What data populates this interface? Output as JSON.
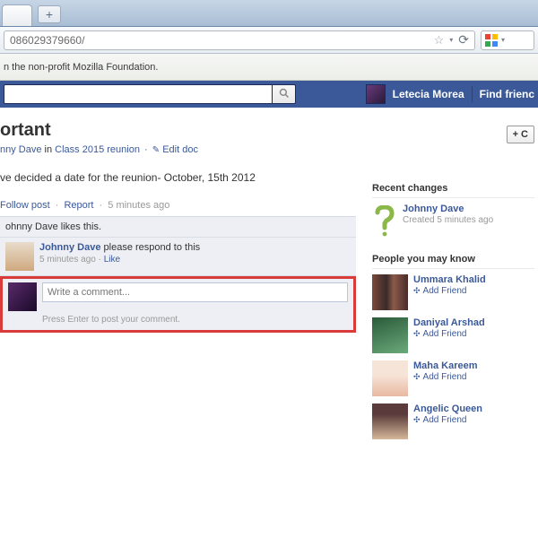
{
  "browser": {
    "url_fragment": "086029379660/",
    "bookmark_bar_text": "n the non-profit Mozilla Foundation."
  },
  "header": {
    "user_name": "Letecia Morea",
    "find_friends": "Find frienc"
  },
  "post": {
    "title": "ortant",
    "author": "nny Dave",
    "in_word": "in",
    "group": "Class 2015 reunion",
    "edit_label": "Edit doc",
    "body_text": "ve decided a date for the reunion- October, 15th 2012",
    "follow_label": "Follow post",
    "report_label": "Report",
    "post_time": "5 minutes ago",
    "likes_text": "ohnny Dave likes this."
  },
  "comment": {
    "author": "Johnny Dave",
    "text": "please respond to this",
    "time": "5 minutes ago",
    "like_label": "Like"
  },
  "write": {
    "placeholder": "Write a comment...",
    "hint": "Press Enter to post your comment."
  },
  "add_button": "+ C",
  "recent_changes": {
    "heading": "Recent changes",
    "name": "Johnny Dave",
    "sub": "Created 5 minutes ago"
  },
  "pymk": {
    "heading": "People you may know",
    "add_friend": "Add Friend",
    "items": [
      {
        "name": "Ummara Khalid"
      },
      {
        "name": "Daniyal Arshad"
      },
      {
        "name": "Maha Kareem"
      },
      {
        "name": "Angelic Queen"
      }
    ]
  }
}
